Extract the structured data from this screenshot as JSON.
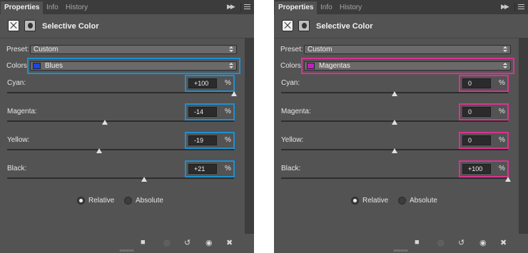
{
  "panels": [
    {
      "tabs": {
        "properties": "Properties",
        "info": "Info",
        "history": "History"
      },
      "title": "Selective Color",
      "preset_label": "Preset:",
      "preset_value": "Custom",
      "colors_label": "Colors:",
      "colors_value": "Blues",
      "swatch_color": "#1a45e8",
      "highlight_color": "#1f8fd0",
      "sliders": [
        {
          "label": "Cyan:",
          "value": "+100",
          "level": 100
        },
        {
          "label": "Magenta:",
          "value": "-14",
          "level": -14
        },
        {
          "label": "Yellow:",
          "value": "-19",
          "level": -19
        },
        {
          "label": "Black:",
          "value": "+21",
          "level": 21
        }
      ],
      "pct": "%",
      "radio_relative": "Relative",
      "radio_absolute": "Absolute",
      "selected_mode": "relative"
    },
    {
      "tabs": {
        "properties": "Properties",
        "info": "Info",
        "history": "History"
      },
      "title": "Selective Color",
      "preset_label": "Preset:",
      "preset_value": "Custom",
      "colors_label": "Colors:",
      "colors_value": "Magentas",
      "swatch_color": "#c020c0",
      "highlight_color": "#d9338f",
      "sliders": [
        {
          "label": "Cyan:",
          "value": "0",
          "level": 0
        },
        {
          "label": "Magenta:",
          "value": "0",
          "level": 0
        },
        {
          "label": "Yellow:",
          "value": "0",
          "level": 0
        },
        {
          "label": "Black:",
          "value": "+100",
          "level": 100
        }
      ],
      "pct": "%",
      "radio_relative": "Relative",
      "radio_absolute": "Absolute",
      "selected_mode": "relative"
    }
  ],
  "icons": {
    "fast_forward": "fast-forward-icon",
    "panel_menu": "panel-menu-icon",
    "adjustment_layer": "adjustment-layer-icon",
    "mask": "mask-icon",
    "clip_to_layer": "clip-to-layer-icon",
    "view_previous": "view-previous-icon",
    "reset": "reset-icon",
    "visibility": "eye-icon",
    "delete": "trash-icon"
  }
}
